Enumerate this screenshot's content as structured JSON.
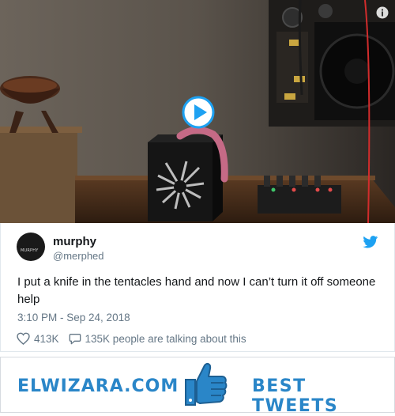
{
  "tweet": {
    "author_name": "murphy",
    "author_handle": "@merphed",
    "avatar_label": "MURPHY",
    "text": "I put a knife in the tentacles hand and now I can’t turn it off someone help",
    "timestamp": "3:10 PM - Sep 24, 2018",
    "likes": "413K",
    "people_talking": "135K people are talking about this"
  },
  "video": {
    "play_icon": "play-icon",
    "info_icon": "info-icon"
  },
  "banner": {
    "site": "ELWIZARA.COM",
    "tagline": "BEST TWEETS",
    "icon": "thumbs-up-icon"
  },
  "colors": {
    "twitter_blue": "#1da1f2",
    "banner_blue": "#2a86c8",
    "text_dark": "#14171a",
    "text_gray": "#657786"
  }
}
